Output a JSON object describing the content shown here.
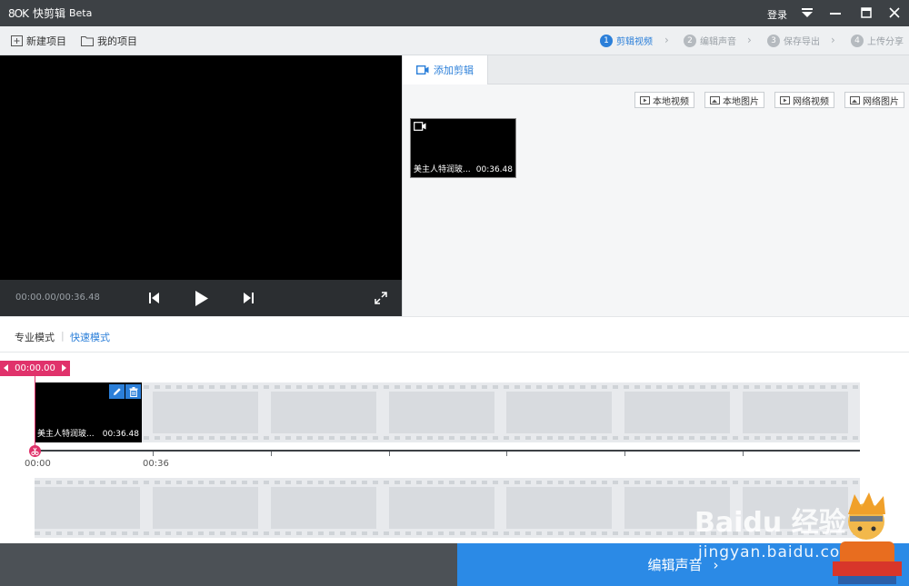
{
  "titlebar": {
    "logo_mark": "8OK",
    "app_name": "快剪辑",
    "app_beta": "Beta",
    "login": "登录"
  },
  "toolbar": {
    "new_project": "新建项目",
    "my_projects": "我的项目",
    "steps": [
      {
        "num": "1",
        "label": "剪辑视频",
        "active": true
      },
      {
        "num": "2",
        "label": "编辑声音",
        "active": false
      },
      {
        "num": "3",
        "label": "保存导出",
        "active": false
      },
      {
        "num": "4",
        "label": "上传分享",
        "active": false
      }
    ]
  },
  "player": {
    "time_readout": "00:00.00/00:36.48"
  },
  "media": {
    "tab_label": "添加剪辑",
    "sources": [
      "本地视频",
      "本地图片",
      "网络视频",
      "网络图片"
    ],
    "clip": {
      "name": "美主人特润玻...",
      "duration": "00:36.48"
    }
  },
  "modes": {
    "pro": "专业模式",
    "separator": "|",
    "fast": "快速模式"
  },
  "timeline": {
    "playhead_time": "00:00.00",
    "clip": {
      "name": "美主人特润玻...",
      "duration": "00:36.48"
    },
    "tick_labels": [
      "00:00",
      "00:36"
    ]
  },
  "footer": {
    "next_label": "编辑声音",
    "next_arrow": "›"
  },
  "watermark": {
    "text": "jingyan.baidu.com",
    "brand": "Baidu 经验"
  },
  "colors": {
    "accent": "#2b7fd9",
    "playhead": "#e0326b",
    "titlebar": "#3d4145",
    "footer": "#4c5156",
    "next_button": "#2b8ae6"
  }
}
